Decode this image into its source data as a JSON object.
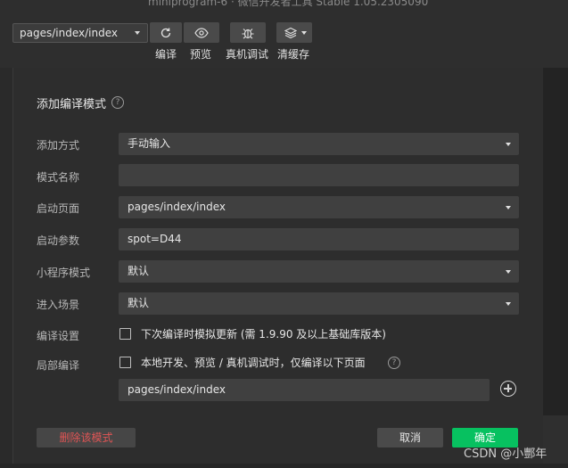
{
  "titlebar": {
    "title": "miniprogram-6 · 微信开发者工具 Stable 1.05.2305090"
  },
  "toolbar": {
    "page_path": "pages/index/index",
    "compile_label": "编译",
    "preview_label": "预览",
    "debug_label": "真机调试",
    "cache_label": "清缓存"
  },
  "dialog": {
    "title": "添加编译模式",
    "rows": {
      "add_mode": {
        "label": "添加方式",
        "value": "手动输入"
      },
      "mode_name": {
        "label": "模式名称",
        "value": ""
      },
      "launch_page": {
        "label": "启动页面",
        "value": "pages/index/index"
      },
      "launch_params": {
        "label": "启动参数",
        "value": "spot=D44"
      },
      "miniprogram_mode": {
        "label": "小程序模式",
        "value": "默认"
      },
      "scene": {
        "label": "进入场景",
        "value": "默认"
      },
      "compile_settings": {
        "label": "编译设置",
        "checkbox_text": "下次编译时模拟更新 (需 1.9.90 及以上基础库版本)"
      },
      "partial_compile": {
        "label": "局部编译",
        "checkbox_text": "本地开发、预览 / 真机调试时，仅编译以下页面",
        "page": "pages/index/index"
      }
    },
    "delete_label": "删除该模式",
    "cancel_label": "取消",
    "ok_label": "确定"
  },
  "colors": {
    "accent": "#07c160",
    "danger": "#e05555",
    "background": "#2d2d2d"
  },
  "watermark": "CSDN @小酆年"
}
